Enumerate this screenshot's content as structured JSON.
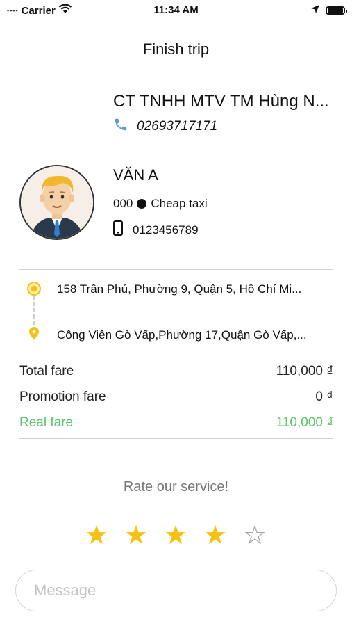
{
  "status_bar": {
    "dots": "••••",
    "carrier": "Carrier",
    "time": "11:34 AM"
  },
  "header": {
    "title": "Finish trip"
  },
  "company": {
    "name": "CT TNHH MTV TM Hùng N...",
    "phone": "02693717171"
  },
  "driver": {
    "name": "VĂN A",
    "plate": "000",
    "car_type": "Cheap taxi",
    "phone": "0123456789"
  },
  "route": {
    "pickup": "158 Trần Phú, Phường 9, Quận 5, Hồ Chí Mi...",
    "dropoff": "Công Viên Gò Vấp,Phường 17,Quận Gò Vấp,..."
  },
  "fares": {
    "total_label": "Total fare",
    "total_value": "110,000 ₫",
    "promotion_label": "Promotion fare",
    "promotion_value": "0 ₫",
    "real_label": "Real fare",
    "real_value": "110,000 ₫"
  },
  "rating": {
    "prompt": "Rate our service!",
    "value": 4,
    "max": 5,
    "filled_symbol": "★",
    "empty_symbol": "☆"
  },
  "message_input": {
    "placeholder": "Message"
  },
  "colors": {
    "accent_yellow": "#f6c10f",
    "real_fare_green": "#5cc56a",
    "divider": "#cfcfcf",
    "placeholder": "#c5c5c5"
  },
  "icons": [
    "wifi-icon",
    "location-arrow-icon",
    "battery-icon",
    "phone-icon",
    "mobile-phone-icon",
    "pickup-location-icon",
    "dropoff-location-icon",
    "star-icon"
  ]
}
